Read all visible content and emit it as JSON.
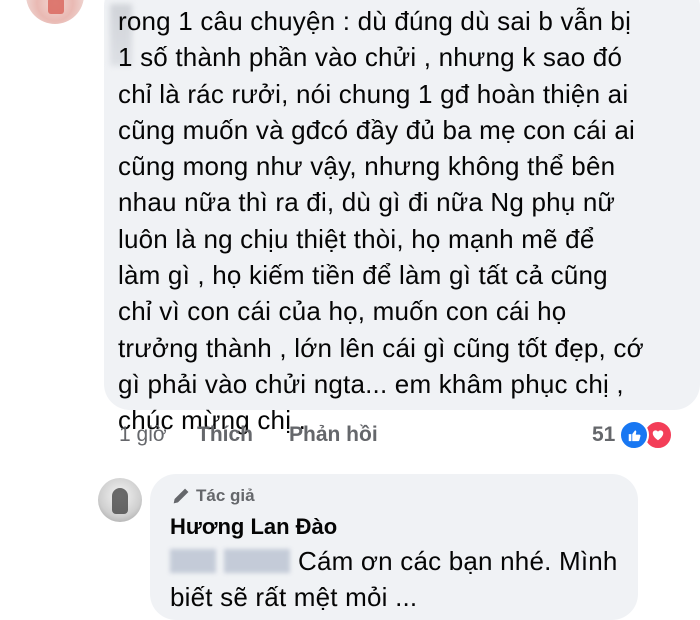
{
  "comment": {
    "lines": [
      "rong 1 câu chuyện : dù đúng dù sai b vẫn bị",
      "1 số thành phần vào chửi , nhưng k sao đó",
      "chỉ là rác rưởi, nói chung 1 gđ hoàn thiện ai",
      "cũng muốn và gđcó đầy đủ ba mẹ con cái ai",
      "cũng mong như vậy, nhưng không thể bên",
      "nhau nữa thì ra đi, dù gì đi nữa Ng phụ nữ",
      "luôn là ng chịu thiệt thòi, họ mạnh mẽ để",
      "làm gì , họ kiếm tiền để làm gì tất cả cũng",
      "chỉ vì con cái của họ, muốn con cái họ",
      "trưởng thành , lớn lên cái gì cũng tốt đẹp, cớ",
      "gì phải vào chửi ngta... em khâm phục chị ,",
      "chúc mừng chị ."
    ],
    "time": "1 giờ",
    "like_label": "Thích",
    "reply_label": "Phản hồi",
    "reaction_count": "51"
  },
  "reply": {
    "badge": "Tác giả",
    "author": "Hương Lan Đào",
    "line1": "Cám ơn các bạn nhé. Mình",
    "line2": "biết sẽ rất mệt mỏi ..."
  },
  "colors": {
    "bubble": "#f0f2f5",
    "meta_text": "#65676b",
    "like_blue": "#1877f2",
    "love_red": "#f33e58"
  }
}
